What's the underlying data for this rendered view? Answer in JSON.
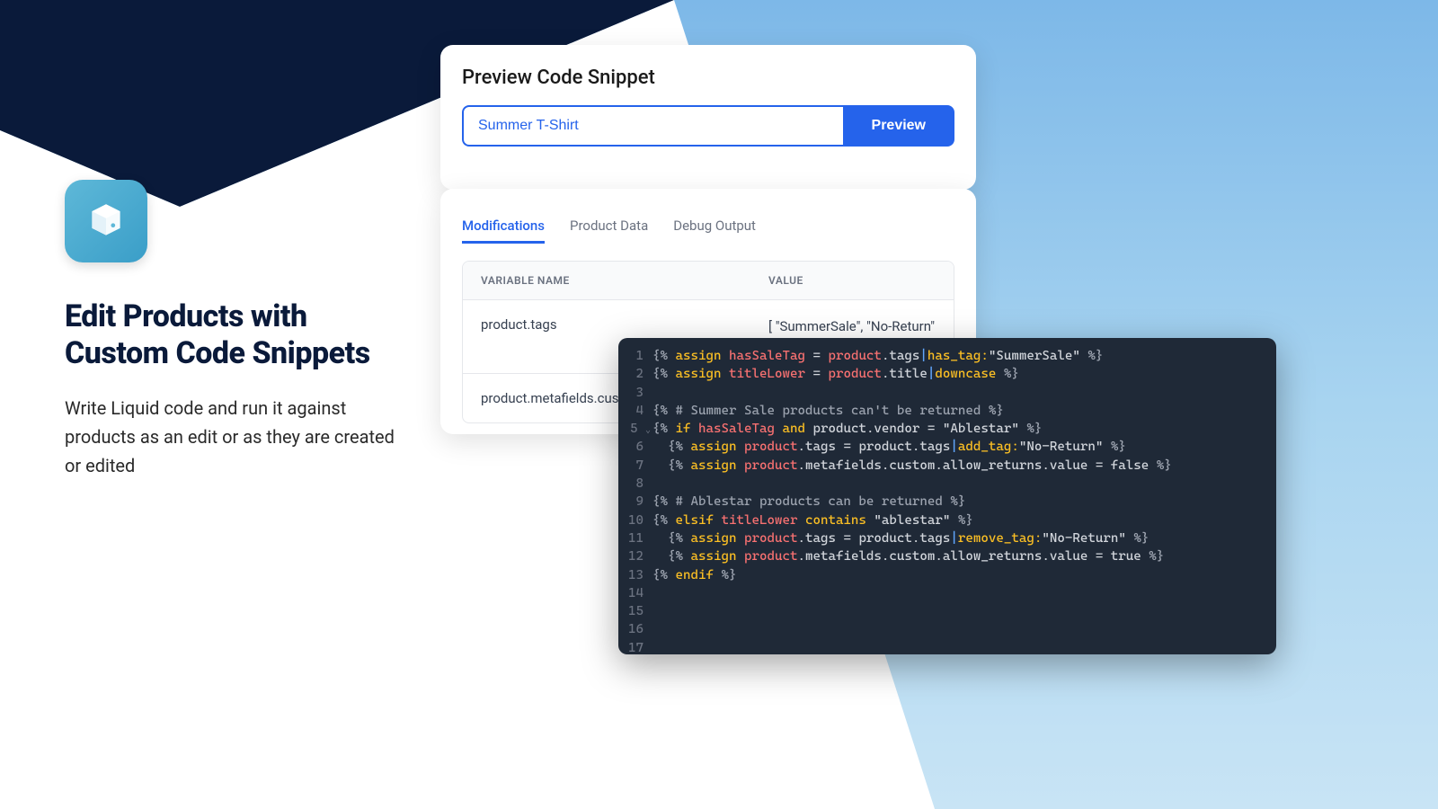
{
  "left": {
    "heading": "Edit Products with Custom Code Snippets",
    "subheading": "Write Liquid code and run it against products as an edit or as they are created or edited"
  },
  "preview": {
    "title": "Preview Code Snippet",
    "input_value": "Summer T-Shirt",
    "button_label": "Preview"
  },
  "tabs": {
    "items": [
      {
        "label": "Modifications",
        "active": true
      },
      {
        "label": "Product Data",
        "active": false
      },
      {
        "label": "Debug Output",
        "active": false
      }
    ]
  },
  "table": {
    "headers": {
      "name": "Variable Name",
      "value": "Value"
    },
    "rows": [
      {
        "name": "product.tags",
        "value": "[ \"SummerSale\", \"No-Return\" ]"
      },
      {
        "name": "product.metafields.custo",
        "value": ""
      }
    ]
  },
  "code": {
    "lines": [
      {
        "n": 1,
        "tokens": [
          [
            "tag",
            "{% "
          ],
          [
            "keyword",
            "assign"
          ],
          [
            "prop",
            " "
          ],
          [
            "var",
            "hasSaleTag"
          ],
          [
            "prop",
            " = "
          ],
          [
            "obj",
            "product"
          ],
          [
            "prop",
            ".tags"
          ],
          [
            "pipe",
            "|"
          ],
          [
            "filter",
            "has_tag:"
          ],
          [
            "string",
            "\"SummerSale\""
          ],
          [
            "tag",
            " %}"
          ]
        ]
      },
      {
        "n": 2,
        "tokens": [
          [
            "tag",
            "{% "
          ],
          [
            "keyword",
            "assign"
          ],
          [
            "prop",
            " "
          ],
          [
            "var",
            "titleLower"
          ],
          [
            "prop",
            " = "
          ],
          [
            "obj",
            "product"
          ],
          [
            "prop",
            ".title"
          ],
          [
            "pipe",
            "|"
          ],
          [
            "filter",
            "downcase"
          ],
          [
            "tag",
            " %}"
          ]
        ]
      },
      {
        "n": 3,
        "tokens": []
      },
      {
        "n": 4,
        "tokens": [
          [
            "tag",
            "{% "
          ],
          [
            "comment",
            "# Summer Sale products can't be returned"
          ],
          [
            "tag",
            " %}"
          ]
        ]
      },
      {
        "n": 5,
        "fold": true,
        "tokens": [
          [
            "tag",
            "{% "
          ],
          [
            "keyword",
            "if"
          ],
          [
            "prop",
            " "
          ],
          [
            "var",
            "hasSaleTag"
          ],
          [
            "prop",
            " "
          ],
          [
            "keyword",
            "and"
          ],
          [
            "prop",
            " product.vendor = \"Ablestar\""
          ],
          [
            "tag",
            " %}"
          ]
        ]
      },
      {
        "n": 6,
        "tokens": [
          [
            "prop",
            "  "
          ],
          [
            "tag",
            "{% "
          ],
          [
            "keyword",
            "assign"
          ],
          [
            "prop",
            " "
          ],
          [
            "obj",
            "product"
          ],
          [
            "prop",
            ".tags = product.tags"
          ],
          [
            "pipe",
            "|"
          ],
          [
            "filter",
            "add_tag:"
          ],
          [
            "string",
            "\"No-Return\""
          ],
          [
            "tag",
            " %}"
          ]
        ]
      },
      {
        "n": 7,
        "tokens": [
          [
            "prop",
            "  "
          ],
          [
            "tag",
            "{% "
          ],
          [
            "keyword",
            "assign"
          ],
          [
            "prop",
            " "
          ],
          [
            "obj",
            "product"
          ],
          [
            "prop",
            ".metafields.custom.allow_returns.value = false"
          ],
          [
            "tag",
            " %}"
          ]
        ]
      },
      {
        "n": 8,
        "tokens": []
      },
      {
        "n": 9,
        "tokens": [
          [
            "tag",
            "{% "
          ],
          [
            "comment",
            "# Ablestar products can be returned"
          ],
          [
            "tag",
            " %}"
          ]
        ]
      },
      {
        "n": 10,
        "tokens": [
          [
            "tag",
            "{% "
          ],
          [
            "keyword",
            "elsif"
          ],
          [
            "prop",
            " "
          ],
          [
            "var",
            "titleLower"
          ],
          [
            "prop",
            " "
          ],
          [
            "keyword",
            "contains"
          ],
          [
            "prop",
            " \"ablestar\""
          ],
          [
            "tag",
            " %}"
          ]
        ]
      },
      {
        "n": 11,
        "tokens": [
          [
            "prop",
            "  "
          ],
          [
            "tag",
            "{% "
          ],
          [
            "keyword",
            "assign"
          ],
          [
            "prop",
            " "
          ],
          [
            "obj",
            "product"
          ],
          [
            "prop",
            ".tags = product.tags"
          ],
          [
            "pipe",
            "|"
          ],
          [
            "filter",
            "remove_tag:"
          ],
          [
            "string",
            "\"No-Return\""
          ],
          [
            "tag",
            " %}"
          ]
        ]
      },
      {
        "n": 12,
        "tokens": [
          [
            "prop",
            "  "
          ],
          [
            "tag",
            "{% "
          ],
          [
            "keyword",
            "assign"
          ],
          [
            "prop",
            " "
          ],
          [
            "obj",
            "product"
          ],
          [
            "prop",
            ".metafields.custom.allow_returns.value = true"
          ],
          [
            "tag",
            " %}"
          ]
        ]
      },
      {
        "n": 13,
        "tokens": [
          [
            "tag",
            "{% "
          ],
          [
            "keyword",
            "endif"
          ],
          [
            "tag",
            " %}"
          ]
        ]
      },
      {
        "n": 14,
        "tokens": []
      },
      {
        "n": 15,
        "tokens": []
      },
      {
        "n": 16,
        "tokens": []
      },
      {
        "n": 17,
        "tokens": []
      }
    ]
  }
}
